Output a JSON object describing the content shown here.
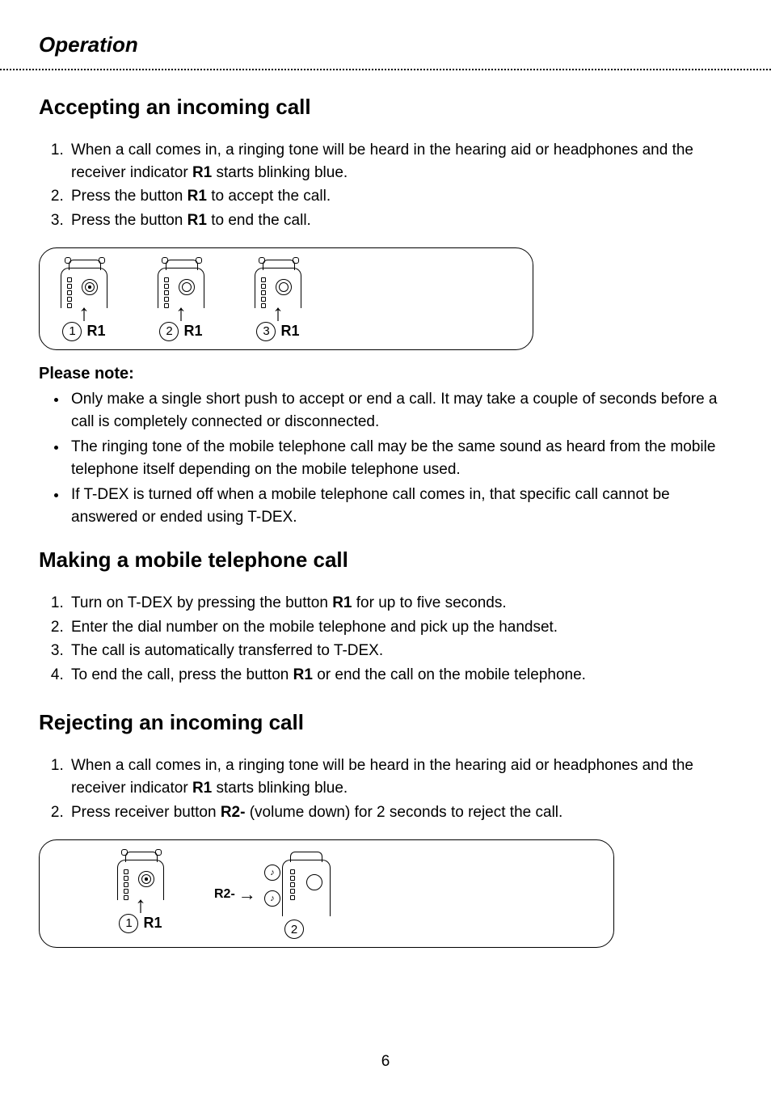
{
  "title": "Operation",
  "accepting": {
    "heading": "Accepting an incoming call",
    "steps": [
      {
        "pre": "When a call comes in, a ringing tone will be heard in the hearing aid or headphones and the receiver indicator ",
        "bold": "R1",
        "post": " starts blinking blue."
      },
      {
        "pre": "Press the button ",
        "bold": "R1",
        "post": " to accept the call."
      },
      {
        "pre": "Press the button ",
        "bold": "R1",
        "post": " to end the call."
      }
    ],
    "figure": {
      "labels": [
        "R1",
        "R1",
        "R1"
      ],
      "steps": [
        "1",
        "2",
        "3"
      ]
    }
  },
  "note": {
    "title": "Please note:",
    "items": [
      "Only make a single short push to accept or end a call. It may take a couple of seconds before a call is completely connected or disconnected.",
      "The ringing tone of the mobile telephone call may be the same sound as heard from the mobile telephone itself depending on the mobile telephone used.",
      "If T-DEX is turned off when a mobile telephone call comes in, that specific call cannot be answered or ended using T-DEX."
    ]
  },
  "making": {
    "heading": "Making a mobile telephone call",
    "steps": [
      {
        "pre": "Turn on T-DEX by pressing the button ",
        "bold": "R1",
        "post": " for up to five seconds."
      },
      {
        "pre": "Enter the dial number on the mobile telephone and pick up the handset.",
        "bold": "",
        "post": ""
      },
      {
        "pre": "The call is automatically transferred to T-DEX.",
        "bold": "",
        "post": ""
      },
      {
        "pre": "To end the call, press the button ",
        "bold": "R1",
        "post": " or end the call on the mobile telephone."
      }
    ]
  },
  "rejecting": {
    "heading": "Rejecting an incoming call",
    "steps": [
      {
        "pre": "When a call comes in, a ringing tone will be heard in the hearing aid or headphones and the receiver indicator ",
        "bold": "R1",
        "post": " starts blinking blue."
      },
      {
        "pre": "Press receiver button ",
        "bold": "R2-",
        "post": " (volume down) for 2 seconds to reject the call."
      }
    ],
    "figure": {
      "step1": {
        "num": "1",
        "label": "R1"
      },
      "step2": {
        "num": "2",
        "sideLabel": "R2-"
      }
    }
  },
  "pageNumber": "6"
}
